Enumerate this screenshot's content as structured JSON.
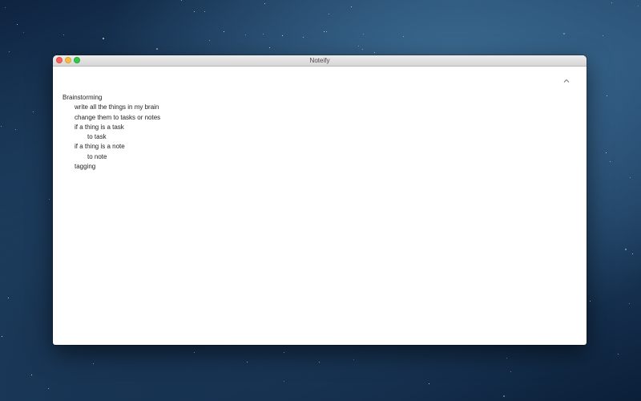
{
  "window": {
    "title": "Noteify"
  },
  "toolbar": {
    "collapse_icon": "chevron-up-icon"
  },
  "outline": {
    "items": [
      {
        "text": "Brainstorming",
        "level": 0
      },
      {
        "text": "write all the things in my brain",
        "level": 1
      },
      {
        "text": "change them to tasks or notes",
        "level": 1
      },
      {
        "text": "if a thing is a task",
        "level": 1
      },
      {
        "text": "to task",
        "level": 2
      },
      {
        "text": "if a thing is a note",
        "level": 1
      },
      {
        "text": "to note",
        "level": 2
      },
      {
        "text": "tagging",
        "level": 1
      }
    ]
  },
  "colors": {
    "close": "#fc605c",
    "minimize": "#fdbc40",
    "zoom": "#34c84a"
  }
}
